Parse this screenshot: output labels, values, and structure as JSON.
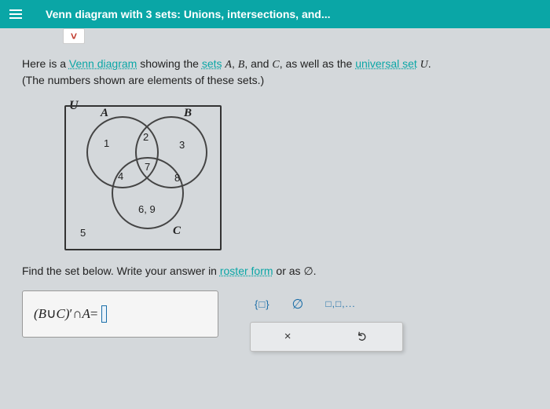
{
  "header": {
    "title": "Venn diagram with 3 sets: Unions, intersections, and..."
  },
  "intro": {
    "line1_pre": "Here is a ",
    "venn_link": "Venn diagram",
    "line1_mid": " showing the ",
    "sets_link": "sets",
    "setA": "A",
    "setB": "B",
    "setC": "C",
    "line1_mid2": ", as well as the ",
    "universal_link": "universal set",
    "setU": "U",
    "line1_end": ".",
    "line2": "(The numbers shown are elements of these sets.)"
  },
  "venn": {
    "U": "U",
    "A": "A",
    "B": "B",
    "C": "C",
    "n1": "1",
    "n2": "2",
    "n3": "3",
    "n4": "4",
    "n7": "7",
    "n8": "8",
    "n69": "6, 9",
    "n5": "5"
  },
  "prompt": {
    "pre": "Find the set below. Write your answer in ",
    "roster_link": "roster form",
    "post": " or as ∅."
  },
  "answer": {
    "expr_open": "(",
    "exprB": "B",
    "union": " ∪ ",
    "exprC": "C",
    "close_paren": ")",
    "prime": "′",
    "inter": " ∩ ",
    "exprA": "A",
    "eq": " = "
  },
  "tools": {
    "braces": "{□}",
    "emptyset": "∅",
    "sequence": "□,□,...",
    "clear": "×",
    "reset": "↺"
  }
}
